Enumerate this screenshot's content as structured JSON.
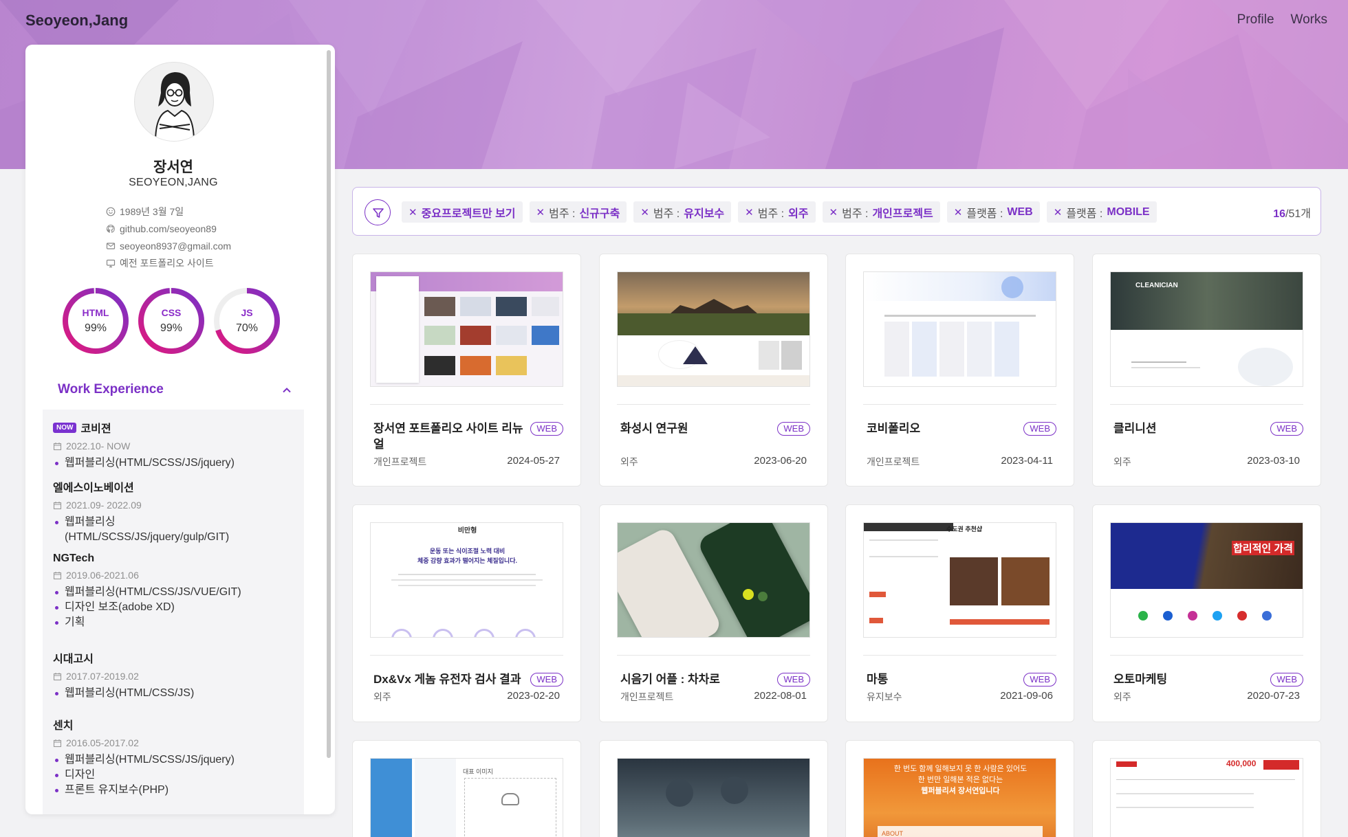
{
  "header": {
    "brand": "Seoyeon,Jang",
    "nav": [
      "Profile",
      "Works"
    ]
  },
  "profile": {
    "name_ko": "장서연",
    "name_en": "SEOYEON,JANG",
    "info": [
      {
        "icon": "smile-icon",
        "text": "1989년 3월 7일"
      },
      {
        "icon": "github-icon",
        "text": "github.com/seoyeon89"
      },
      {
        "icon": "mail-icon",
        "text": "seoyeon8937@gmail.com"
      },
      {
        "icon": "monitor-icon",
        "text": "예전 포트폴리오 사이트"
      }
    ],
    "skills": [
      {
        "label": "HTML",
        "value": "99%",
        "percent": 99
      },
      {
        "label": "CSS",
        "value": "99%",
        "percent": 99
      },
      {
        "label": "JS",
        "value": "70%",
        "percent": 70
      }
    ],
    "work_title": "Work Experience",
    "jobs": [
      {
        "now": "NOW",
        "company": "코비젼",
        "date": "2022.10- NOW",
        "items": [
          "웹퍼블리싱(HTML/SCSS/JS/jquery)"
        ]
      },
      {
        "company": "엘에스이노베이션",
        "date": "2021.09- 2022.09",
        "items": [
          "웹퍼블리싱\n(HTML/SCSS/JS/jquery/gulp/GIT)"
        ]
      },
      {
        "company": "NGTech",
        "date": "2019.06-2021.06",
        "items": [
          "웹퍼블리싱(HTML/CSS/JS/VUE/GIT)",
          "디자인 보조(adobe XD)",
          "기획"
        ]
      },
      {
        "company": "시대고시",
        "date": "2017.07-2019.02",
        "items": [
          "웹퍼블리싱(HTML/CSS/JS)"
        ]
      },
      {
        "company": "센치",
        "date": "2016.05-2017.02",
        "items": [
          "웹퍼블리싱(HTML/SCSS/JS/jquery)",
          "디자인",
          "프론트 유지보수(PHP)"
        ]
      }
    ]
  },
  "filters": {
    "chips": [
      {
        "prefix": "",
        "value": "중요프로젝트만 보기"
      },
      {
        "prefix": "범주 : ",
        "value": "신규구축"
      },
      {
        "prefix": "범주 : ",
        "value": "유지보수"
      },
      {
        "prefix": "범주 : ",
        "value": "외주"
      },
      {
        "prefix": "범주 : ",
        "value": "개인프로젝트"
      },
      {
        "prefix": "플랫폼 : ",
        "value": "WEB"
      },
      {
        "prefix": "플랫폼 : ",
        "value": "MOBILE"
      }
    ],
    "count_shown": "16",
    "count_total": "/51개"
  },
  "works": [
    {
      "title": "장서연 포트폴리오 사이트 리뉴얼",
      "badge": "WEB",
      "category": "개인프로젝트",
      "date": "2024-05-27"
    },
    {
      "title": "화성시 연구원",
      "badge": "WEB",
      "category": "외주",
      "date": "2023-06-20"
    },
    {
      "title": "코비폴리오",
      "badge": "WEB",
      "category": "개인프로젝트",
      "date": "2023-04-11"
    },
    {
      "title": "클리니션",
      "badge": "WEB",
      "category": "외주",
      "date": "2023-03-10"
    },
    {
      "title": "Dx&Vx 게놈 유전자 검사 결과",
      "badge": "WEB",
      "category": "외주",
      "date": "2023-02-20"
    },
    {
      "title": "시음기 어플 : 차차로",
      "badge": "WEB",
      "category": "개인프로젝트",
      "date": "2022-08-01"
    },
    {
      "title": "마통",
      "badge": "WEB",
      "category": "유지보수",
      "date": "2021-09-06"
    },
    {
      "title": "오토마케팅",
      "badge": "WEB",
      "category": "외주",
      "date": "2020-07-23"
    }
  ],
  "thumb_text": {
    "cleanician": "CLEANICIAN",
    "bimanhyeong": "비만형",
    "diet_line1": "운동 또는 식이조절 노력 대비",
    "diet_line2": "체중 감량 효과가 떨어지는 체질입니다.",
    "auto_banner": "합리적인 가격",
    "mattong": "수도권 추천샵",
    "flower_line1": "한 번도 함께 일해보지 못 한 사람은 있어도",
    "flower_line2": "한 번만 일해본 적은 없다는",
    "flower_line3": "웹퍼블리셔 장서연입니다",
    "flower_about": "ABOUT",
    "form_label": "대표 이미지",
    "price": "400,000"
  },
  "colors": {
    "accent": "#7b30c6",
    "gauge_start": "#e0197d",
    "gauge_end": "#7b30c6"
  }
}
